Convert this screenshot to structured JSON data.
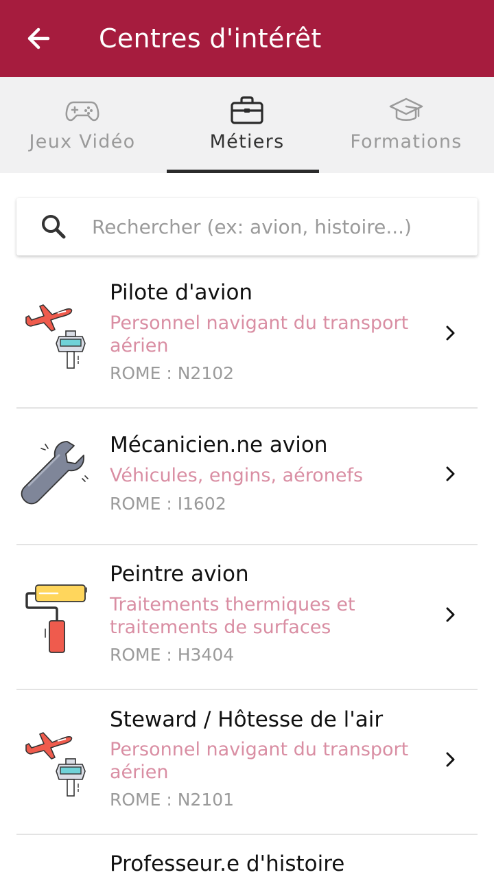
{
  "appbar": {
    "title": "Centres d'intérêt",
    "back_icon": "arrow-left-icon",
    "background": "#a61c3e"
  },
  "tabs": [
    {
      "label": "Jeux Vidéo",
      "icon": "gamepad-icon",
      "active": false
    },
    {
      "label": "Métiers",
      "icon": "briefcase-icon",
      "active": true
    },
    {
      "label": "Formations",
      "icon": "graduation-cap-icon",
      "active": false
    }
  ],
  "search": {
    "placeholder": "Rechercher (ex: avion, histoire...)",
    "value": "",
    "icon": "search-icon"
  },
  "jobs": [
    {
      "title": "Pilote d'avion",
      "category": "Personnel navigant du transport aérien",
      "code": "ROME : N2102",
      "icon": "airplane-control-tower-icon"
    },
    {
      "title": "Mécanicien.ne avion",
      "category": "Véhicules, engins, aéronefs",
      "code": "ROME : I1602",
      "icon": "wrench-icon"
    },
    {
      "title": "Peintre avion",
      "category": "Traitements thermiques et traitements de surfaces",
      "code": "ROME : H3404",
      "icon": "paint-roller-icon"
    },
    {
      "title": "Steward / Hôtesse de l'air",
      "category": "Personnel navigant du transport aérien",
      "code": "ROME : N2101",
      "icon": "airplane-control-tower-icon"
    },
    {
      "title": "Professeur.e d'histoire",
      "category": "",
      "code": "",
      "icon": ""
    }
  ],
  "colors": {
    "accent": "#a61c3e",
    "category_text": "#d98ea3",
    "muted_text": "#9a9a9a",
    "tab_bar": "#f1f1f2"
  }
}
